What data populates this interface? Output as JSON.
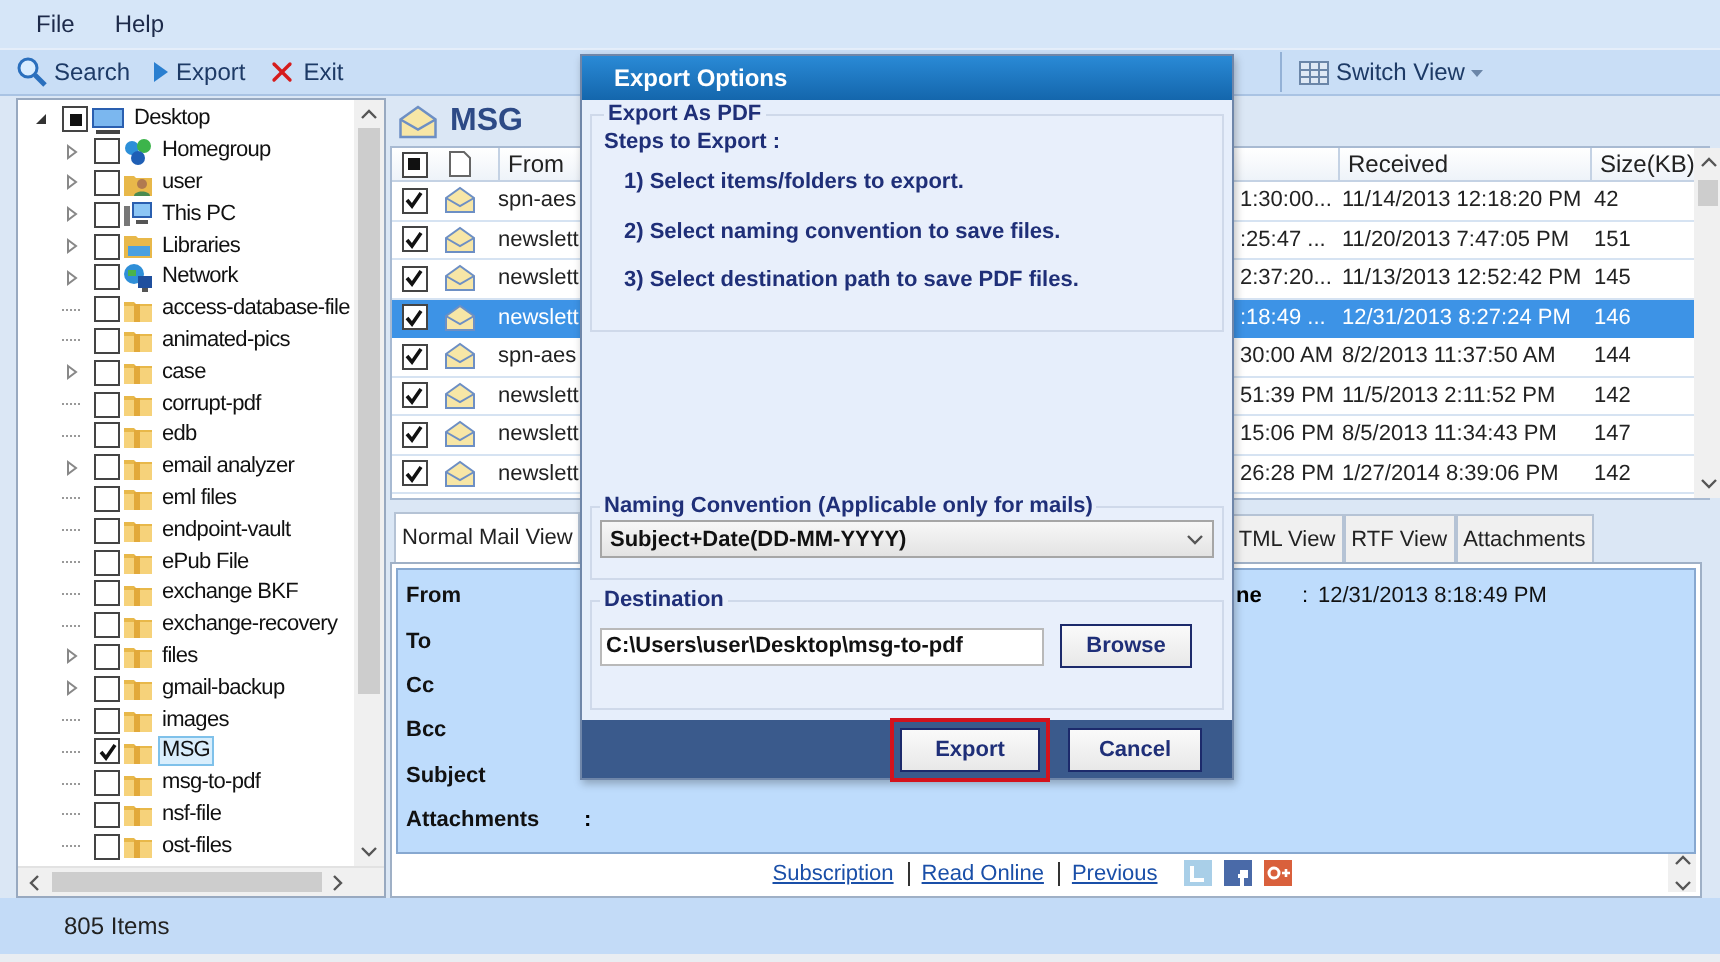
{
  "menu": [
    "File",
    "Help"
  ],
  "toolbar": {
    "buttons": [
      {
        "label": "Search",
        "kind": "search"
      },
      {
        "label": "Export",
        "kind": "export"
      },
      {
        "label": "Exit",
        "kind": "exit"
      }
    ],
    "switch_view": "Switch View"
  },
  "tree": {
    "items": [
      {
        "label": "Desktop",
        "kind": "computer",
        "mixed": true,
        "expanded": true,
        "selected": false,
        "children": [
          {
            "label": "Homegroup",
            "kind": "homegroup",
            "checked": false,
            "expandable": true,
            "selected": false
          },
          {
            "label": "user",
            "kind": "user",
            "checked": false,
            "expandable": true,
            "selected": false
          },
          {
            "label": "This PC",
            "kind": "pc",
            "checked": false,
            "expandable": true,
            "selected": false
          },
          {
            "label": "Libraries",
            "kind": "libraries",
            "checked": false,
            "expandable": true,
            "selected": false
          },
          {
            "label": "Network",
            "kind": "network",
            "checked": false,
            "expandable": true,
            "selected": false
          },
          {
            "label": "access-database-file",
            "kind": "folder",
            "checked": false,
            "expandable": false,
            "selected": false
          },
          {
            "label": "animated-pics",
            "kind": "folder",
            "checked": false,
            "expandable": false,
            "selected": false
          },
          {
            "label": "case",
            "kind": "folder",
            "checked": false,
            "expandable": true,
            "selected": false
          },
          {
            "label": "corrupt-pdf",
            "kind": "folder",
            "checked": false,
            "expandable": false,
            "selected": false
          },
          {
            "label": "edb",
            "kind": "folder",
            "checked": false,
            "expandable": false,
            "selected": false
          },
          {
            "label": "email analyzer",
            "kind": "folder",
            "checked": false,
            "expandable": true,
            "selected": false
          },
          {
            "label": "eml files",
            "kind": "folder",
            "checked": false,
            "expandable": false,
            "selected": false
          },
          {
            "label": "endpoint-vault",
            "kind": "folder",
            "checked": false,
            "expandable": false,
            "selected": false
          },
          {
            "label": "ePub File",
            "kind": "folder",
            "checked": false,
            "expandable": false,
            "selected": false
          },
          {
            "label": "exchange BKF",
            "kind": "folder",
            "checked": false,
            "expandable": false,
            "selected": false
          },
          {
            "label": "exchange-recovery",
            "kind": "folder",
            "checked": false,
            "expandable": false,
            "selected": false
          },
          {
            "label": "files",
            "kind": "folder",
            "checked": false,
            "expandable": true,
            "selected": false
          },
          {
            "label": "gmail-backup",
            "kind": "folder",
            "checked": false,
            "expandable": true,
            "selected": false
          },
          {
            "label": "images",
            "kind": "folder",
            "checked": false,
            "expandable": false,
            "selected": false
          },
          {
            "label": "MSG",
            "kind": "folder",
            "checked": true,
            "expandable": false,
            "selected": true
          },
          {
            "label": "msg-to-pdf",
            "kind": "folder",
            "checked": false,
            "expandable": false,
            "selected": false
          },
          {
            "label": "nsf-file",
            "kind": "folder",
            "checked": false,
            "expandable": false,
            "selected": false
          },
          {
            "label": "ost-files",
            "kind": "folder",
            "checked": false,
            "expandable": false,
            "selected": false
          }
        ]
      }
    ]
  },
  "folder_view": {
    "title": "MSG",
    "header_check": {
      "mixed": true
    },
    "columns": [
      "From",
      "Received",
      "Size(KB)"
    ],
    "rows": [
      {
        "checked": true,
        "selected": false,
        "from": "spn-aes",
        "column_2": "1:30:00...",
        "received": "11/14/2013 12:18:20 PM",
        "size": "42"
      },
      {
        "checked": true,
        "selected": false,
        "from": "newslett",
        "column_2": ":25:47 ...",
        "received": "11/20/2013 7:47:05 PM",
        "size": "151"
      },
      {
        "checked": true,
        "selected": false,
        "from": "newslett",
        "column_2": "2:37:20...",
        "received": "11/13/2013 12:52:42 PM",
        "size": "145"
      },
      {
        "checked": true,
        "selected": true,
        "from": "newslett",
        "column_2": ":18:49 ...",
        "received": "12/31/2013 8:27:24 PM",
        "size": "146"
      },
      {
        "checked": true,
        "selected": false,
        "from": "spn-aes",
        "column_2": "30:00 AM",
        "received": "8/2/2013 11:37:50 AM",
        "size": "144"
      },
      {
        "checked": true,
        "selected": false,
        "from": "newslett",
        "column_2": "51:39 PM",
        "received": "11/5/2013 2:11:52 PM",
        "size": "142"
      },
      {
        "checked": true,
        "selected": false,
        "from": "newslett",
        "column_2": "15:06 PM",
        "received": "8/5/2013 11:34:43 PM",
        "size": "147"
      },
      {
        "checked": true,
        "selected": false,
        "from": "newslett",
        "column_2": "26:28 PM",
        "received": "1/27/2014 8:39:06 PM",
        "size": "142"
      }
    ],
    "tabs": [
      {
        "label": "Normal Mail View",
        "selected": true
      },
      {
        "label": "TML View",
        "selected": false
      },
      {
        "label": "RTF View",
        "selected": false
      },
      {
        "label": "Attachments",
        "selected": false
      }
    ],
    "fields": [
      {
        "label": "From"
      },
      {
        "label": "To"
      },
      {
        "label": "Cc"
      },
      {
        "label": "Bcc"
      },
      {
        "label": "Subject"
      },
      {
        "label": "Attachments",
        "separator": ":"
      }
    ],
    "date": {
      "label": "ne",
      "separator": ":",
      "value": "12/31/2013 8:18:49 PM"
    },
    "links": [
      "Subscription",
      "Read Online",
      "Previous"
    ]
  },
  "status_bar": "805 Items",
  "dialog": {
    "title": "Export Options",
    "section": "Export As PDF",
    "steps_title": "Steps to Export :",
    "steps": [
      "1) Select items/folders to export.",
      "2) Select naming convention to save files.",
      "3) Select destination path to save PDF files."
    ],
    "naming": {
      "label": "Naming Convention (Applicable only for mails)",
      "value": "Subject+Date(DD-MM-YYYY)"
    },
    "destination": {
      "label": "Destination",
      "value": "C:\\Users\\user\\Desktop\\msg-to-pdf",
      "browse": "Browse"
    },
    "buttons": [
      {
        "label": "Export",
        "highlighted": true
      },
      {
        "label": "Cancel",
        "highlighted": false
      }
    ]
  }
}
